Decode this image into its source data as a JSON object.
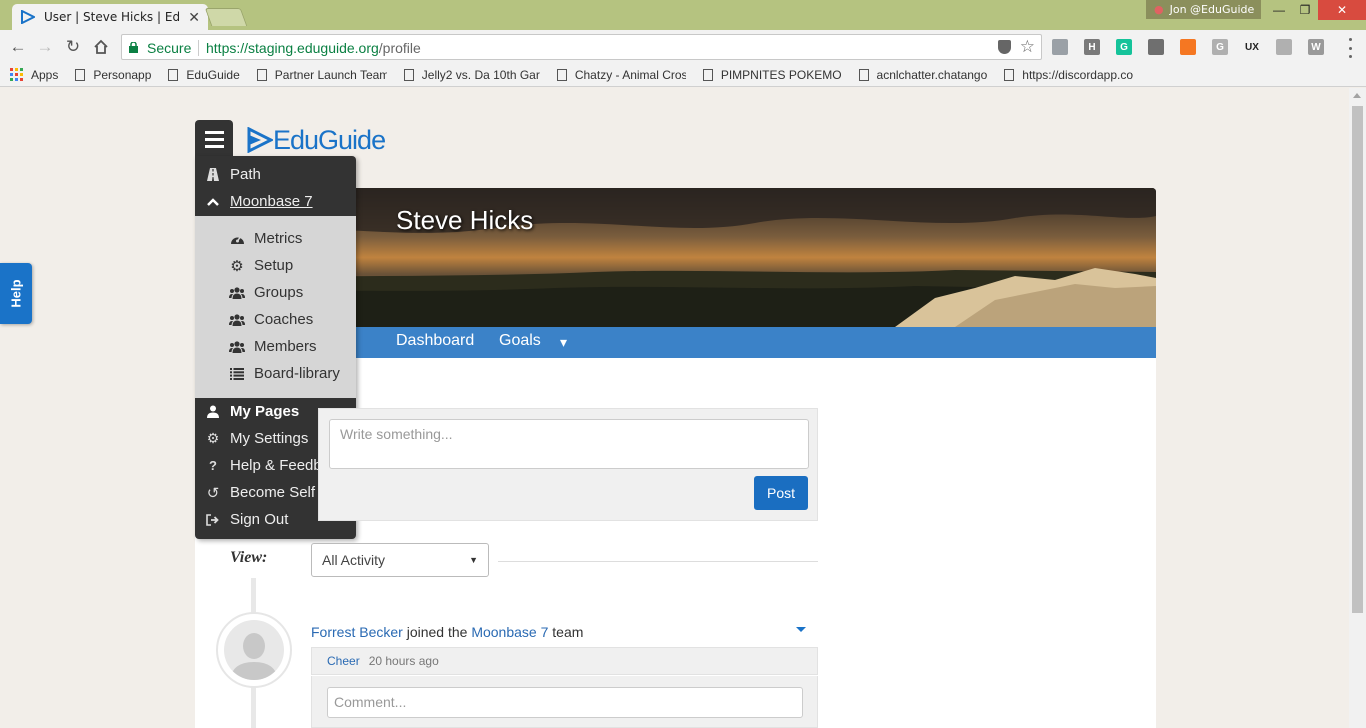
{
  "browser": {
    "tab_title": "User | Steve Hicks | EduG",
    "profile_name": "Jon @EduGuide",
    "secure_label": "Secure",
    "url_host": "https://staging.eduguide.org",
    "url_path": "/profile",
    "bookmarks": [
      {
        "label": "Apps"
      },
      {
        "label": "Personapp"
      },
      {
        "label": "EduGuide"
      },
      {
        "label": "Partner Launch Team"
      },
      {
        "label": "Jelly2 vs. Da 10th Gar"
      },
      {
        "label": "Chatzy - Animal Cros"
      },
      {
        "label": "PIMPNITES POKEMO"
      },
      {
        "label": "acnlchatter.chatango"
      },
      {
        "label": "https://discordapp.co"
      }
    ],
    "extensions": [
      {
        "icon": "globe-icon",
        "text": "",
        "color": "#9aa0a6"
      },
      {
        "icon": "h-icon",
        "text": "H",
        "color": "#7a7a7a"
      },
      {
        "icon": "grammarly-icon",
        "text": "G",
        "color": "#15c39a"
      },
      {
        "icon": "camera-icon",
        "text": "",
        "color": "#6f6f6f"
      },
      {
        "icon": "hubspot-icon",
        "text": "",
        "color": "#f57722"
      },
      {
        "icon": "g-icon",
        "text": "G",
        "color": "#b0b0b0"
      },
      {
        "icon": "ux-icon",
        "text": "UX",
        "color": "#222222"
      },
      {
        "icon": "record-icon",
        "text": "",
        "color": "#b0b0b0"
      },
      {
        "icon": "w-icon",
        "text": "W",
        "color": "#9a9a9a"
      }
    ]
  },
  "page": {
    "help_label": "Help",
    "logo_text": "EduGuide",
    "profile_name": "Steve Hicks",
    "tabs": [
      {
        "label": "Dashboard"
      },
      {
        "label": "Goals"
      }
    ],
    "tab_dropdown": "▾",
    "menu": {
      "items_top": [
        {
          "label": "Path",
          "icon": "road-icon"
        },
        {
          "label": "Moonbase 7",
          "icon": "chevron-up-icon"
        }
      ],
      "submenu": [
        {
          "label": "Metrics",
          "icon": "dashboard-icon"
        },
        {
          "label": "Setup",
          "icon": "gear-icon"
        },
        {
          "label": "Groups",
          "icon": "users-icon"
        },
        {
          "label": "Coaches",
          "icon": "users-icon"
        },
        {
          "label": "Members",
          "icon": "users-icon"
        },
        {
          "label": "Board-library",
          "icon": "list-icon"
        }
      ],
      "items_bottom": [
        {
          "label": "My Pages",
          "icon": "user-icon"
        },
        {
          "label": "My Settings",
          "icon": "cogs-icon"
        },
        {
          "label": "Help & Feedback",
          "icon": "question-icon"
        },
        {
          "label": "Become Self",
          "icon": "undo-icon"
        },
        {
          "label": "Sign Out",
          "icon": "sign-out-icon"
        }
      ]
    },
    "post": {
      "placeholder": "Write something...",
      "button": "Post"
    },
    "view": {
      "label": "View:",
      "selected": "All Activity"
    },
    "activity": {
      "actor": "Forrest Becker",
      "verb": " joined the ",
      "target": "Moonbase 7",
      "suffix": " team",
      "cheer": "Cheer",
      "time": "20 hours ago",
      "comment_placeholder": "Comment..."
    }
  },
  "colors": {
    "accent": "#1a73c8",
    "tab_bar": "#3b82c8",
    "menu_bg": "#333333",
    "submenu_bg": "#d6d6d6",
    "page_bg": "#f2eee9",
    "titlebar": "#b5c380"
  }
}
